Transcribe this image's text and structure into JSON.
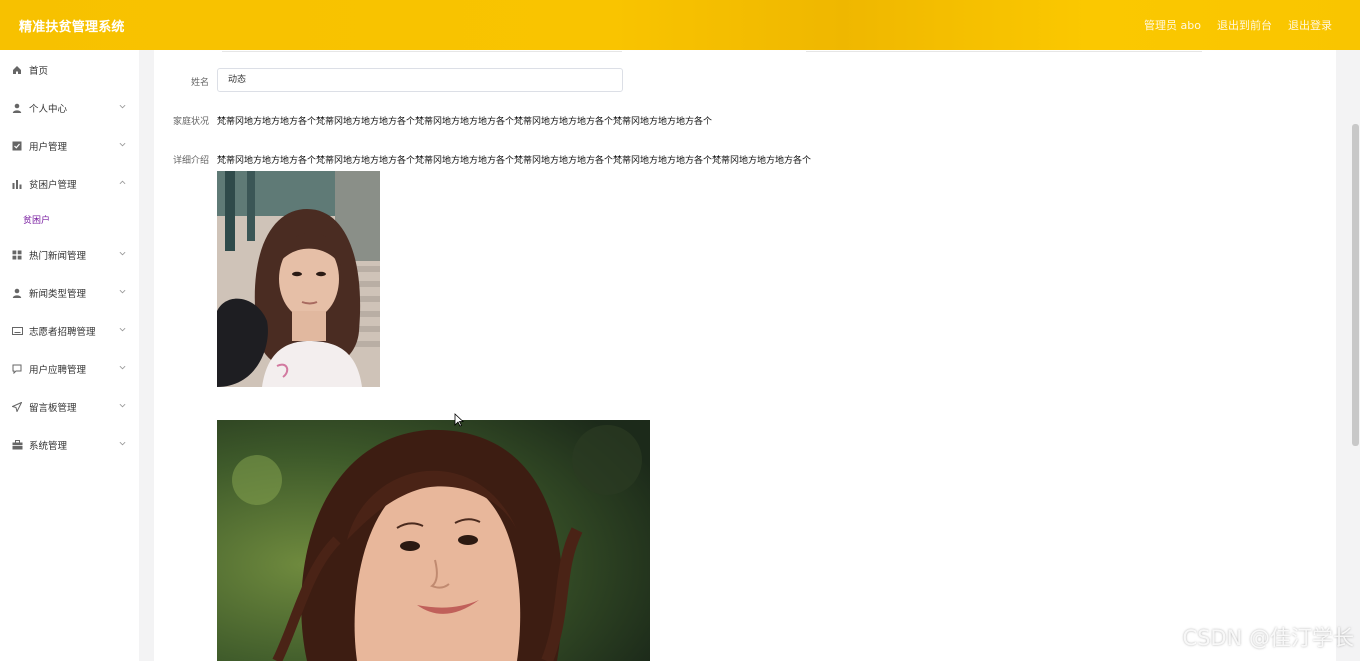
{
  "header": {
    "title": "精准扶贫管理系统",
    "admin_label": "管理员 abo",
    "back_front_label": "退出到前台",
    "logout_label": "退出登录"
  },
  "sidebar": {
    "items": [
      {
        "label": "首页",
        "icon": "home-icon"
      },
      {
        "label": "个人中心",
        "icon": "user-icon"
      },
      {
        "label": "用户管理",
        "icon": "checkbox-icon"
      },
      {
        "label": "贫困户管理",
        "icon": "bar-chart-icon"
      },
      {
        "label": "热门新闻管理",
        "icon": "grid-icon"
      },
      {
        "label": "新闻类型管理",
        "icon": "user-icon"
      },
      {
        "label": "志愿者招聘管理",
        "icon": "card-icon"
      },
      {
        "label": "用户应聘管理",
        "icon": "chat-icon"
      },
      {
        "label": "留言板管理",
        "icon": "send-icon"
      },
      {
        "label": "系统管理",
        "icon": "briefcase-icon"
      }
    ],
    "sub_item": "贫困户"
  },
  "form": {
    "name_label": "姓名",
    "name_value": "动态",
    "family_label": "家庭状况",
    "family_value": "梵蒂冈地方地方地方各个梵蒂冈地方地方地方各个梵蒂冈地方地方地方各个梵蒂冈地方地方地方各个梵蒂冈地方地方地方各个",
    "detail_label": "详细介绍",
    "detail_value": "梵蒂冈地方地方地方各个梵蒂冈地方地方地方各个梵蒂冈地方地方地方各个梵蒂冈地方地方地方各个梵蒂冈地方地方地方各个梵蒂冈地方地方地方各个"
  },
  "watermark": "CSDN @佳汀学长",
  "colors": {
    "header": "#f9c400",
    "active_sub": "#7a1fa2"
  }
}
